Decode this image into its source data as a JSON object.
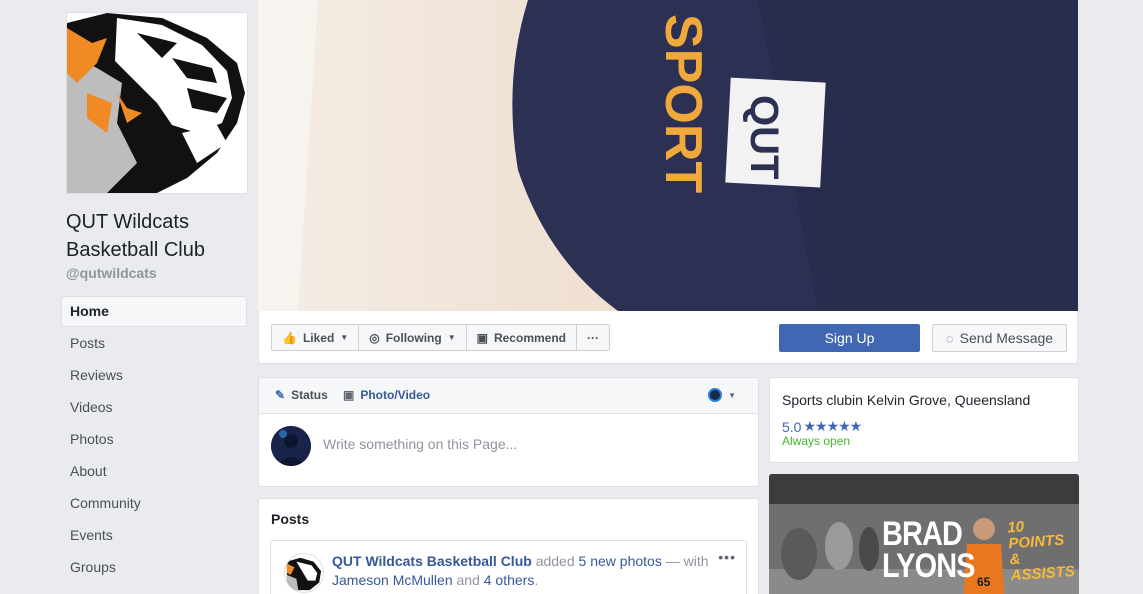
{
  "page": {
    "name": "QUT Wildcats Basketball Club",
    "handle": "@qutwildcats"
  },
  "nav": [
    {
      "label": "Home",
      "active": true
    },
    {
      "label": "Posts"
    },
    {
      "label": "Reviews"
    },
    {
      "label": "Videos"
    },
    {
      "label": "Photos"
    },
    {
      "label": "About"
    },
    {
      "label": "Community"
    },
    {
      "label": "Events"
    },
    {
      "label": "Groups"
    }
  ],
  "cover": {
    "sleeve_text": "SPORT",
    "badge_text": "QUT"
  },
  "actions": {
    "liked": "Liked",
    "following": "Following",
    "recommend": "Recommend",
    "more": "···",
    "sign_up": "Sign Up",
    "send_message": "Send Message"
  },
  "composer": {
    "status_tab": "Status",
    "photo_tab": "Photo/Video",
    "placeholder": "Write something on this Page..."
  },
  "posts": {
    "title": "Posts",
    "first": {
      "author": "QUT Wildcats Basketball Club",
      "action": "added",
      "object": "5 new photos",
      "with_text": "— with",
      "tagged": "Jameson McMullen",
      "and_text": "and",
      "others": "4 others",
      "period": "."
    },
    "more": "•••"
  },
  "about": {
    "category": "Sports clubin Kelvin Grove, Queensland",
    "rating": "5.0",
    "stars": "★★★★★",
    "hours": "Always open"
  },
  "promo": {
    "name_line1": "BRAD",
    "name_line2": "LYONS",
    "stat_line1": "10 POINTS",
    "stat_line2": "& ASSISTS",
    "jersey": "65"
  },
  "colors": {
    "brand_blue": "#4267b2",
    "link_blue": "#365899",
    "open_green": "#42b72a",
    "cover_navy": "#2a2f52",
    "sport_orange": "#f2a93b"
  }
}
